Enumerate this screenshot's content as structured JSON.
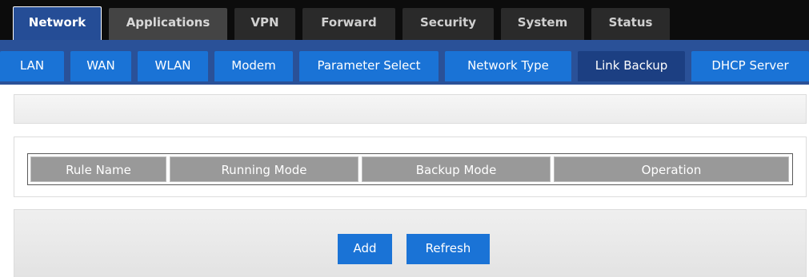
{
  "top_tabs": [
    {
      "label": "Network",
      "active": true
    },
    {
      "label": "Applications"
    },
    {
      "label": "VPN"
    },
    {
      "label": "Forward"
    },
    {
      "label": "Security"
    },
    {
      "label": "System"
    },
    {
      "label": "Status"
    }
  ],
  "sub_tabs": [
    {
      "label": "LAN"
    },
    {
      "label": "WAN"
    },
    {
      "label": "WLAN"
    },
    {
      "label": "Modem"
    },
    {
      "label": "Parameter Select"
    },
    {
      "label": "Network Type"
    },
    {
      "label": "Link Backup",
      "active": true
    },
    {
      "label": "DHCP Server"
    }
  ],
  "table": {
    "columns": [
      "Rule Name",
      "Running Mode",
      "Backup Mode",
      "Operation"
    ]
  },
  "actions": {
    "add_label": "Add",
    "refresh_label": "Refresh"
  },
  "colors": {
    "top_nav_bg": "#0c0c0c",
    "active_top_tab": "#254d96",
    "sub_nav_bg": "#2a5198",
    "sub_tab": "#1a73d6",
    "active_sub_tab": "#1c3f82",
    "table_header": "#999999",
    "button": "#1a73d6"
  }
}
